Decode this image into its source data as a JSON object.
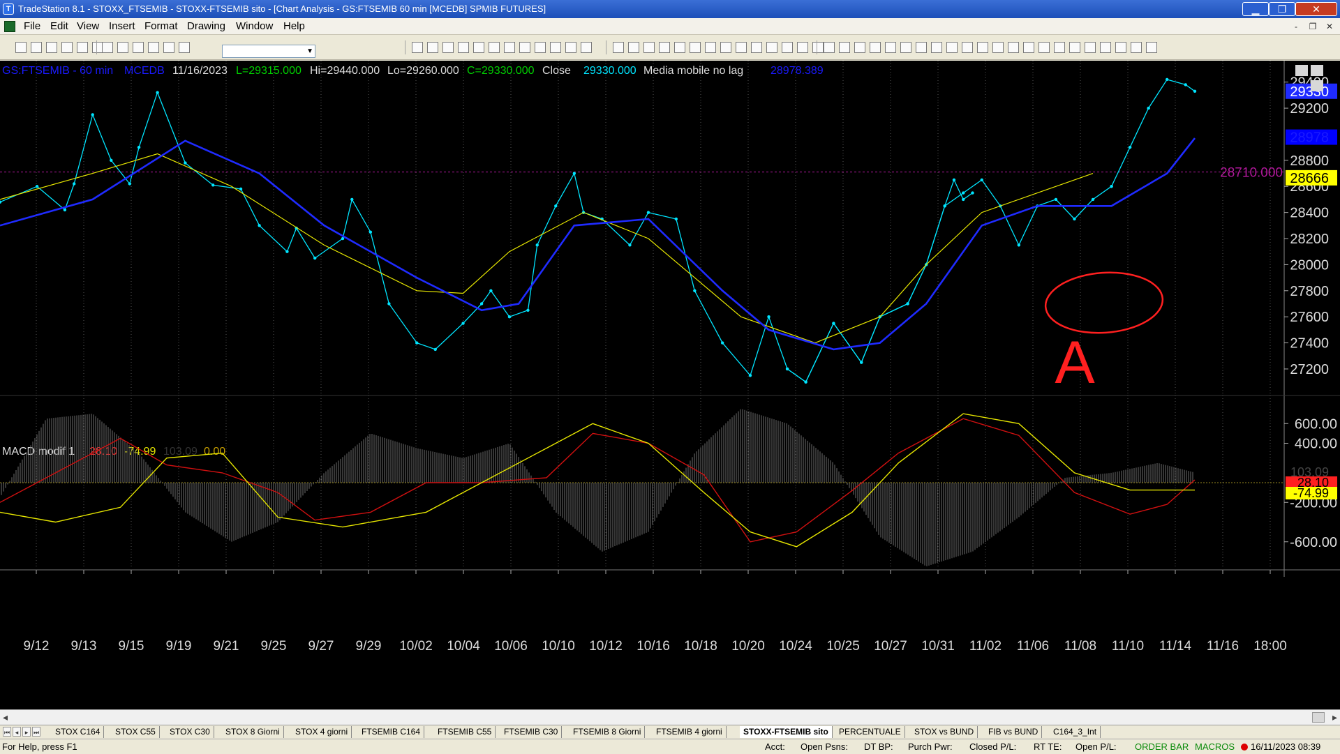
{
  "window": {
    "title": "TradeStation 8.1 - STOXX_FTSEMIB - STOXX-FTSEMIB sito - [Chart Analysis - GS:FTSEMIB  60 min  [MCEDB] SPMIB FUTURES]",
    "minimize": "▁",
    "maximize": "❐",
    "close": "✕"
  },
  "menu": [
    "File",
    "Edit",
    "View",
    "Insert",
    "Format",
    "Drawing",
    "Window",
    "Help"
  ],
  "mdi_buttons": [
    "-",
    "❐",
    "✕"
  ],
  "chart_header": {
    "symbol": "GS:FTSEMIB - 60 min",
    "feed": "MCEDB",
    "date": "11/16/2023",
    "last": "L=29315.000",
    "high": "Hi=29440.000",
    "low": "Lo=29260.000",
    "close": "C=29330.000",
    "close_label": "Close",
    "close_value": "29330.000",
    "ma_label": "Media mobile no lag",
    "ma_value": "28978.389"
  },
  "macd_header": {
    "label": "MACD modif 1",
    "v1": "28.10",
    "v2": "-74.99",
    "v3": "103.09",
    "v4": "0.00"
  },
  "colors": {
    "price": "#00e5ff",
    "ma_yellow": "#e6e600",
    "ma_blue": "#1f2bff",
    "hline": "#b0189a",
    "macd_red": "#d01010",
    "macd_yellow": "#e6e600",
    "histogram": "#6e6e6e",
    "annotation": "#ff2020"
  },
  "chart_data": [
    {
      "type": "line",
      "title": "GS:FTSEMIB - 60 min",
      "x_ticks": [
        "9/12",
        "9/13",
        "9/15",
        "9/19",
        "9/21",
        "9/25",
        "9/27",
        "9/29",
        "10/02",
        "10/04",
        "10/06",
        "10/10",
        "10/12",
        "10/16",
        "10/18",
        "10/20",
        "10/24",
        "10/25",
        "10/27",
        "10/31",
        "11/02",
        "11/06",
        "11/08",
        "11/10",
        "11/14",
        "11/16",
        "18:00"
      ],
      "y_ticks": [
        "29400",
        "29200",
        "28800",
        "28600",
        "28400",
        "28200",
        "28000",
        "27800",
        "27600",
        "27400",
        "27200"
      ],
      "ylim": [
        27050,
        29500
      ],
      "x_range": [
        0,
        210
      ],
      "series": [
        {
          "name": "",
          "role": "price",
          "x": [
            0,
            8,
            14,
            16,
            20,
            24,
            28,
            30,
            34,
            40,
            46,
            52,
            56,
            62,
            64,
            68,
            74,
            76,
            80,
            84,
            90,
            94,
            100,
            104,
            106,
            110,
            114,
            116,
            120,
            124,
            126,
            130,
            136,
            140,
            146,
            150,
            156,
            162,
            166,
            170,
            174,
            180,
            186,
            190,
            196,
            200,
            204,
            206,
            208,
            210
          ],
          "y": [
            28480,
            28600,
            28420,
            28620,
            29150,
            28800,
            28620,
            28900,
            29320,
            28780,
            28610,
            28580,
            28300,
            28100,
            28280,
            28050,
            28200,
            28500,
            28250,
            27700,
            27400,
            27350,
            27550,
            27700,
            27800,
            27600,
            27650,
            28150,
            28450,
            28700,
            28400,
            28350,
            28150,
            28400,
            28350,
            27800,
            27400,
            27150,
            27600,
            27200,
            27100,
            27550,
            27250,
            27600,
            27700,
            28000,
            28450,
            28650,
            28500,
            28550
          ]
        },
        {
          "name": "",
          "role": "price",
          "x": [
            170,
            174,
            180,
            186,
            190,
            196,
            200,
            204,
            208,
            212,
            216,
            220,
            224,
            228,
            232,
            236,
            240
          ],
          "y": [
            27200,
            27100,
            27550,
            27250,
            27600,
            27700,
            28000,
            28450,
            28550,
            28650,
            28450,
            28150,
            28450,
            28500,
            28350,
            28500,
            28600
          ]
        },
        {
          "name": "",
          "role": "price",
          "x": [
            240,
            244,
            248,
            252,
            256,
            258
          ],
          "y": [
            28600,
            28900,
            29200,
            29420,
            29380,
            29330
          ]
        },
        {
          "name": "",
          "role": "ma_yellow",
          "x": [
            0,
            20,
            34,
            50,
            70,
            90,
            100,
            110,
            126,
            140,
            150,
            160,
            176,
            190,
            200,
            212,
            224,
            236
          ],
          "y": [
            28500,
            28700,
            28850,
            28600,
            28150,
            27800,
            27780,
            28100,
            28400,
            28200,
            27900,
            27600,
            27400,
            27600,
            28000,
            28400,
            28550,
            28700
          ]
        },
        {
          "name": "",
          "role": "ma_blue",
          "x": [
            0,
            20,
            40,
            56,
            70,
            90,
            104,
            112,
            124,
            140,
            156,
            166,
            180,
            190,
            200,
            212,
            224,
            240,
            252,
            258
          ],
          "y": [
            28300,
            28500,
            28950,
            28700,
            28300,
            27900,
            27650,
            27700,
            28300,
            28350,
            27800,
            27500,
            27350,
            27400,
            27700,
            28300,
            28450,
            28450,
            28700,
            28970
          ]
        }
      ],
      "reference_line": 28710,
      "reference_label": "28710.000",
      "price_labels": [
        "29330",
        "28978",
        "28666"
      ],
      "annotation_text": "A",
      "grid": true
    },
    {
      "type": "line",
      "title": "MACD modif 1",
      "y_ticks": [
        "600.00",
        "400.00",
        "-200.00",
        "-600.00"
      ],
      "ylim": [
        -800,
        800
      ],
      "x_range": [
        0,
        210
      ],
      "value_labels": [
        "103.09",
        "28.10",
        "-74.99"
      ],
      "series": [
        {
          "name": "",
          "role": "macd_red",
          "x": [
            0,
            12,
            26,
            36,
            48,
            60,
            68,
            80,
            92,
            104,
            118,
            128,
            140,
            152,
            162,
            172,
            184,
            194,
            208,
            220,
            232,
            244,
            252,
            258
          ],
          "y": [
            -200,
            100,
            450,
            180,
            100,
            -100,
            -380,
            -300,
            0,
            0,
            50,
            500,
            400,
            80,
            -600,
            -500,
            -80,
            300,
            650,
            480,
            -100,
            -320,
            -220,
            28
          ]
        },
        {
          "name": "",
          "role": "macd_yellow",
          "x": [
            0,
            12,
            26,
            36,
            48,
            60,
            74,
            92,
            104,
            118,
            128,
            140,
            152,
            162,
            172,
            184,
            194,
            208,
            220,
            232,
            244,
            258
          ],
          "y": [
            -300,
            -400,
            -250,
            250,
            300,
            -350,
            -450,
            -300,
            0,
            350,
            600,
            400,
            -100,
            -500,
            -650,
            -300,
            200,
            700,
            600,
            100,
            -75,
            -75
          ]
        }
      ],
      "histogram": {
        "x": [
          0,
          10,
          20,
          30,
          40,
          50,
          60,
          70,
          80,
          90,
          100,
          110,
          120,
          130,
          140,
          150,
          160,
          170,
          180,
          190,
          200,
          210,
          220,
          230,
          240,
          250,
          258
        ],
        "y": [
          -150,
          650,
          700,
          300,
          -300,
          -600,
          -400,
          100,
          500,
          350,
          250,
          400,
          -300,
          -700,
          -500,
          300,
          750,
          600,
          200,
          -550,
          -850,
          -700,
          -350,
          50,
          100,
          200,
          103
        ]
      }
    }
  ],
  "tabs": [
    "STOX C164",
    "STOX C55",
    "STOX C30",
    "STOX 8 Giorni",
    "STOX 4 giorni",
    "FTSEMIB C164",
    "FTSEMIB C55",
    "FTSEMIB C30",
    "FTSEMIB 8 Giorni",
    "FTSEMIB 4 giorni",
    "STOXX-FTSEMIB sito",
    "PERCENTUALE",
    "STOX vs BUND",
    "FIB vs BUND",
    "C164_3_Int"
  ],
  "status": {
    "help": "For Help, press F1",
    "acct": "Acct:",
    "open_psns": "Open Psns:",
    "dt_bp": "DT BP:",
    "purch_pwr": "Purch Pwr:",
    "closed_pl": "Closed P/L:",
    "rt_te": "RT TE:",
    "open_pl": "Open P/L:",
    "order_bar": "ORDER BAR",
    "macros": "MACROS",
    "datetime": "16/11/2023 08:39"
  }
}
